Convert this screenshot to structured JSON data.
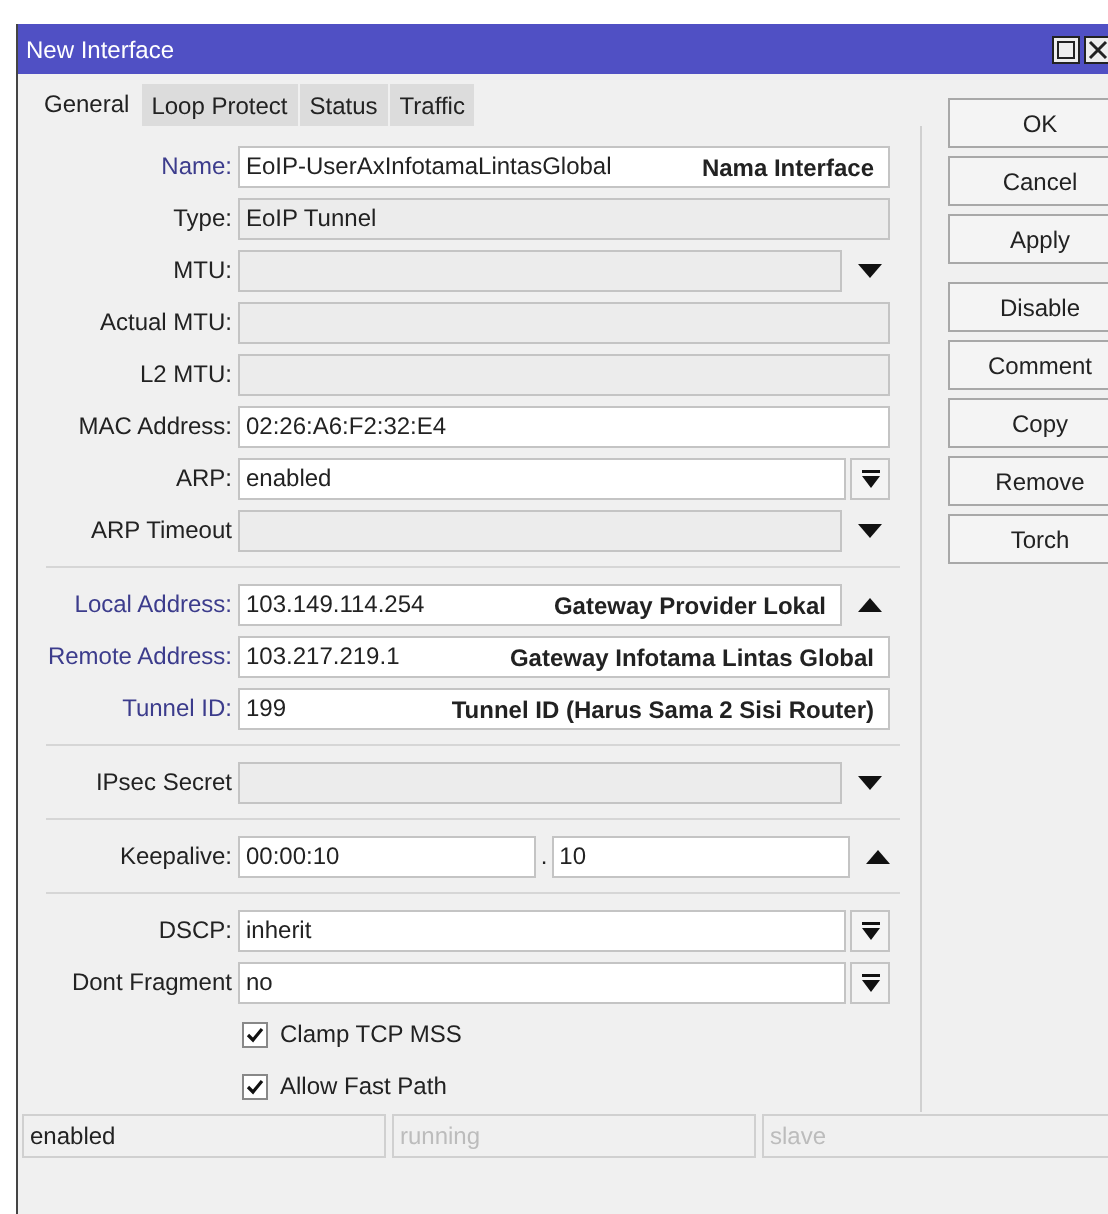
{
  "window": {
    "title": "New Interface"
  },
  "tabs": [
    {
      "label": "General",
      "selected": true
    },
    {
      "label": "Loop Protect",
      "selected": false
    },
    {
      "label": "Status",
      "selected": false
    },
    {
      "label": "Traffic",
      "selected": false
    }
  ],
  "form": [
    {
      "kind": "text",
      "label": "Name:",
      "value": "EoIP-UserAxInfotamaLintasGlobal",
      "required": true,
      "annotation": "Nama Interface"
    },
    {
      "kind": "readonly",
      "label": "Type:",
      "value": "EoIP Tunnel",
      "required": false
    },
    {
      "kind": "dropdown",
      "label": "MTU:",
      "required": false
    },
    {
      "kind": "readonly",
      "label": "Actual MTU:",
      "required": false
    },
    {
      "kind": "readonly",
      "label": "L2 MTU:",
      "required": false
    },
    {
      "kind": "text",
      "label": "MAC Address:",
      "value": "02:26:A6:F2:32:E4",
      "required": false
    },
    {
      "kind": "select",
      "label": "ARP:",
      "value": "enabled",
      "required": false
    },
    {
      "kind": "dropdown",
      "label": "ARP Timeout",
      "required": false
    },
    {
      "kind": "separator"
    },
    {
      "kind": "updown",
      "label": "Local Address:",
      "value": "103.149.114.254",
      "required": true,
      "annotation": "Gateway Provider Lokal"
    },
    {
      "kind": "text",
      "label": "Remote Address:",
      "value": "103.217.219.1",
      "required": true,
      "annotation": "Gateway Infotama Lintas Global"
    },
    {
      "kind": "text",
      "label": "Tunnel ID:",
      "value": "199",
      "required": true,
      "annotation": "Tunnel ID (Harus Sama 2 Sisi Router)"
    },
    {
      "kind": "separator"
    },
    {
      "kind": "dropdown",
      "label": "IPsec Secret",
      "required": false
    },
    {
      "kind": "separator"
    },
    {
      "kind": "dual",
      "label": "Keepalive:",
      "value": "00:00:10",
      "joiner": ".",
      "value2": "10",
      "required": false
    },
    {
      "kind": "separator"
    },
    {
      "kind": "select",
      "label": "DSCP:",
      "value": "inherit",
      "required": false
    },
    {
      "kind": "select",
      "label": "Dont Fragment",
      "value": "no",
      "required": false
    },
    {
      "kind": "checkbox",
      "label": "Clamp TCP MSS",
      "checked": true
    },
    {
      "kind": "checkbox",
      "label": "Allow Fast Path",
      "checked": true
    }
  ],
  "buttons": [
    "OK",
    "Cancel",
    "Apply",
    "Disable",
    "Comment",
    "Copy",
    "Remove",
    "Torch"
  ],
  "status_bar": [
    {
      "text": "enabled",
      "disabled": false
    },
    {
      "text": "running",
      "disabled": true
    },
    {
      "text": "slave",
      "disabled": true
    }
  ]
}
